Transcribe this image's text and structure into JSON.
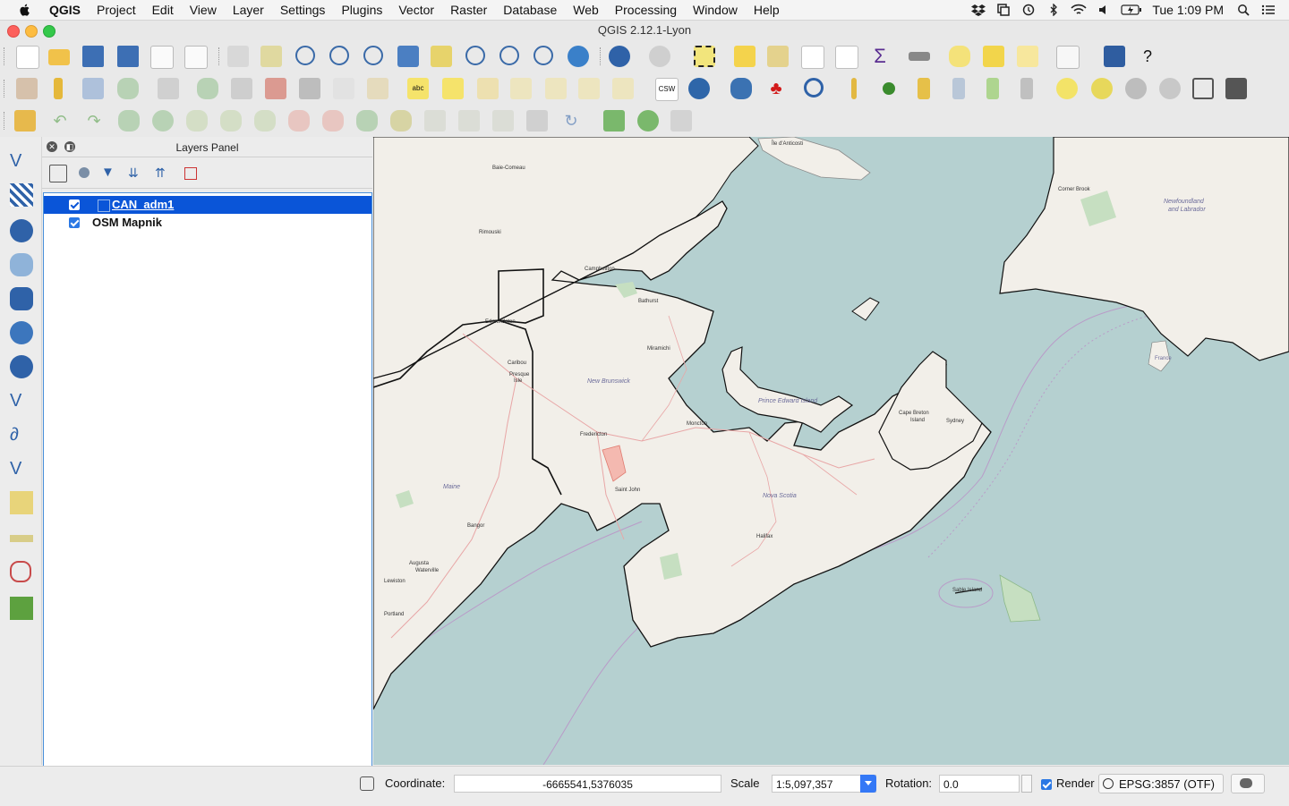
{
  "menubar": {
    "app": "QGIS",
    "items": [
      "Project",
      "Edit",
      "View",
      "Layer",
      "Settings",
      "Plugins",
      "Vector",
      "Raster",
      "Database",
      "Web",
      "Processing",
      "Window",
      "Help"
    ],
    "clock": "Tue 1:09 PM"
  },
  "window": {
    "title": "QGIS 2.12.1-Lyon"
  },
  "layers_panel": {
    "title": "Layers Panel",
    "layers": [
      {
        "name": "CAN_adm1",
        "checked": true,
        "selected": true
      },
      {
        "name": "OSM Mapnik",
        "checked": true,
        "selected": false
      }
    ]
  },
  "map": {
    "labels": {
      "anticosti": "Île d'Anticosti",
      "corner_brook": "Corner Brook",
      "nfl": "Newfoundland",
      "nfl2": "and Labrador",
      "rimouski": "Rimouski",
      "baie_comeau": "Baie-Comeau",
      "campbellton": "Campbellton",
      "bathurst": "Bathurst",
      "edmundston": "Edmundston",
      "miramichi": "Miramichi",
      "caribou": "Caribou",
      "presque_isle": "Presque",
      "presque_isle2": "Isle",
      "new_brunswick": "New Brunswick",
      "moncton": "Moncton",
      "fredericton": "Fredericton",
      "pei": "Prince Edward Island",
      "cape_breton": "Cape Breton",
      "cape_breton2": "Island",
      "sydney": "Sydney",
      "saint_john": "Saint John",
      "nova_scotia": "Nova Scotia",
      "halifax": "Halifax",
      "maine": "Maine",
      "bangor": "Bangor",
      "waterville": "Waterville",
      "augusta": "Augusta",
      "lewiston": "Lewiston",
      "portland": "Portland",
      "france": "France",
      "sable": "Sable Island"
    }
  },
  "status": {
    "coordinate_label": "Coordinate:",
    "coordinate_value": "-6665541,5376035",
    "scale_label": "Scale",
    "scale_value": "1:5,097,357",
    "rotation_label": "Rotation:",
    "rotation_value": "0.0",
    "render_label": "Render",
    "render_checked": true,
    "crs": "EPSG:3857 (OTF)"
  }
}
